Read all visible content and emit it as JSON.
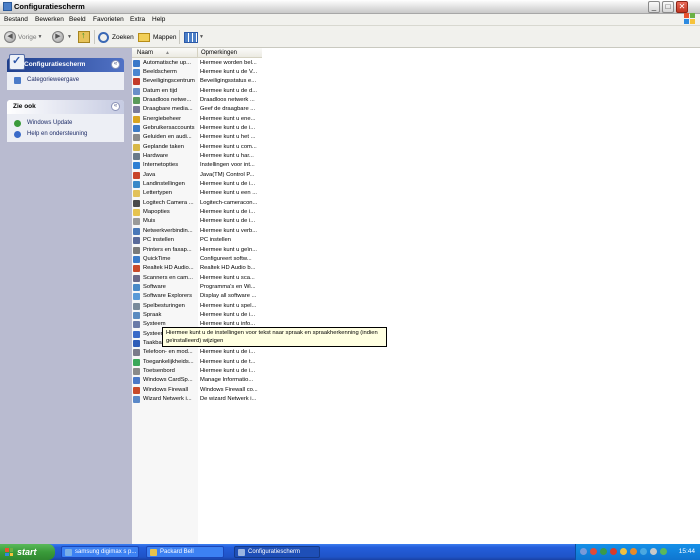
{
  "window": {
    "title": "Configuratiescherm"
  },
  "menu": [
    "Bestand",
    "Bewerken",
    "Beeld",
    "Favorieten",
    "Extra",
    "Help"
  ],
  "toolbar": {
    "back": "Vorige",
    "search": "Zoeken",
    "folders": "Mappen"
  },
  "sidebar": {
    "cp_title": "Configuratiescherm",
    "cp_link": "Categorieweergave",
    "see_also_title": "Zie ook",
    "see_also_links": [
      "Windows Update",
      "Help en ondersteuning"
    ]
  },
  "columns": {
    "name": "Naam",
    "comment": "Opmerkingen"
  },
  "items": [
    {
      "name": "Automatische up...",
      "comment": "Hiermee worden bel...",
      "color": "#3a78c9"
    },
    {
      "name": "Beeldscherm",
      "comment": "Hiermee kunt u de V...",
      "color": "#4a86d0"
    },
    {
      "name": "Beveiligingscentrum",
      "comment": "Beveiligingsstatus e...",
      "color": "#c23b2a"
    },
    {
      "name": "Datum en tijd",
      "comment": "Hiermee kunt u de d...",
      "color": "#6a8fc8"
    },
    {
      "name": "Draadloos netwe...",
      "comment": "Draadloos netwerk ...",
      "color": "#5a9a5a"
    },
    {
      "name": "Draagbare media...",
      "comment": "Geef de draagbare ...",
      "color": "#7a7a9a"
    },
    {
      "name": "Energiebeheer",
      "comment": "Hiermee kunt u ene...",
      "color": "#d9a520"
    },
    {
      "name": "Gebruikersaccounts",
      "comment": "Hiermee kunt u de i...",
      "color": "#3c7ac6"
    },
    {
      "name": "Geluiden en audi...",
      "comment": "Hiermee kunt u het ...",
      "color": "#8a8a8a"
    },
    {
      "name": "Geplande taken",
      "comment": "Hiermee kunt u com...",
      "color": "#d8b848"
    },
    {
      "name": "Hardware",
      "comment": "Hiermee kunt u har...",
      "color": "#6a7a8a"
    },
    {
      "name": "Internetopties",
      "comment": "Instellingen voor int...",
      "color": "#2e7ed3"
    },
    {
      "name": "Java",
      "comment": "Java(TM) Control P...",
      "color": "#c8442a"
    },
    {
      "name": "Landinstellingen",
      "comment": "Hiermee kunt u de i...",
      "color": "#3a88c8"
    },
    {
      "name": "Lettertypen",
      "comment": "Hiermee kunt u een ...",
      "color": "#e2c15a"
    },
    {
      "name": "Logitech Camera ...",
      "comment": "Logitech-cameracon...",
      "color": "#4a4a4a"
    },
    {
      "name": "Mapopties",
      "comment": "Hiermee kunt u de i...",
      "color": "#e6c34e"
    },
    {
      "name": "Muis",
      "comment": "Hiermee kunt u de i...",
      "color": "#9a9a9a"
    },
    {
      "name": "Netwerkverbindin...",
      "comment": "Hiermee kunt u verb...",
      "color": "#4a78b8"
    },
    {
      "name": "PC instellen",
      "comment": "PC instellen",
      "color": "#5a6a9a"
    },
    {
      "name": "Printers en faxap...",
      "comment": "Hiermee kunt u geïn...",
      "color": "#7a7a7a"
    },
    {
      "name": "QuickTime",
      "comment": "Configureert softw...",
      "color": "#3a7ac8"
    },
    {
      "name": "Realtek HD Audio...",
      "comment": "Realtek HD Audio b...",
      "color": "#c84a2a"
    },
    {
      "name": "Scanners en cam...",
      "comment": "Hiermee kunt u sca...",
      "color": "#6a6a8a"
    },
    {
      "name": "Software",
      "comment": "Programma's en Wi...",
      "color": "#4a8ac8"
    },
    {
      "name": "Software Explorers",
      "comment": "Display all software ...",
      "color": "#5a9ad8"
    },
    {
      "name": "Spelbesturingen",
      "comment": "Hiermee kunt u spel...",
      "color": "#7a8a9a"
    },
    {
      "name": "Spraak",
      "comment": "Hiermee kunt u de i...",
      "color": "#5a8ac0"
    },
    {
      "name": "Systeem",
      "comment": "Hiermee kunt u info...",
      "color": "#6a7aa8"
    },
    {
      "name": "Systeem",
      "comment": "",
      "color": "#3a6ac8"
    },
    {
      "name": "Taakba",
      "comment": "",
      "color": "#2e5cb8"
    },
    {
      "name": "Telefoon- en mod...",
      "comment": "Hiermee kunt u de i...",
      "color": "#7a7a8a"
    },
    {
      "name": "Toegankelijkheids...",
      "comment": "Hiermee kunt u de t...",
      "color": "#3aa85a"
    },
    {
      "name": "Toetsenbord",
      "comment": "Hiermee kunt u de i...",
      "color": "#8a8a8a"
    },
    {
      "name": "Windows CardSp...",
      "comment": "Manage Informatio...",
      "color": "#4a78c8"
    },
    {
      "name": "Windows Firewall",
      "comment": "Windows Firewall co...",
      "color": "#c84a2a"
    },
    {
      "name": "Wizard Netwerk i...",
      "comment": "De wizard Netwerk i...",
      "color": "#5a88c8"
    }
  ],
  "tooltip": "Hiermee kunt u de instellingen voor tekst naar spraak en spraakherkenning (indien geïnstalleerd) wijzigen",
  "taskbar": {
    "start": "start",
    "tasks": [
      "samsung digimax s p...",
      "Packard Bell",
      "Configuratiescherm"
    ],
    "clock": "15:44"
  }
}
